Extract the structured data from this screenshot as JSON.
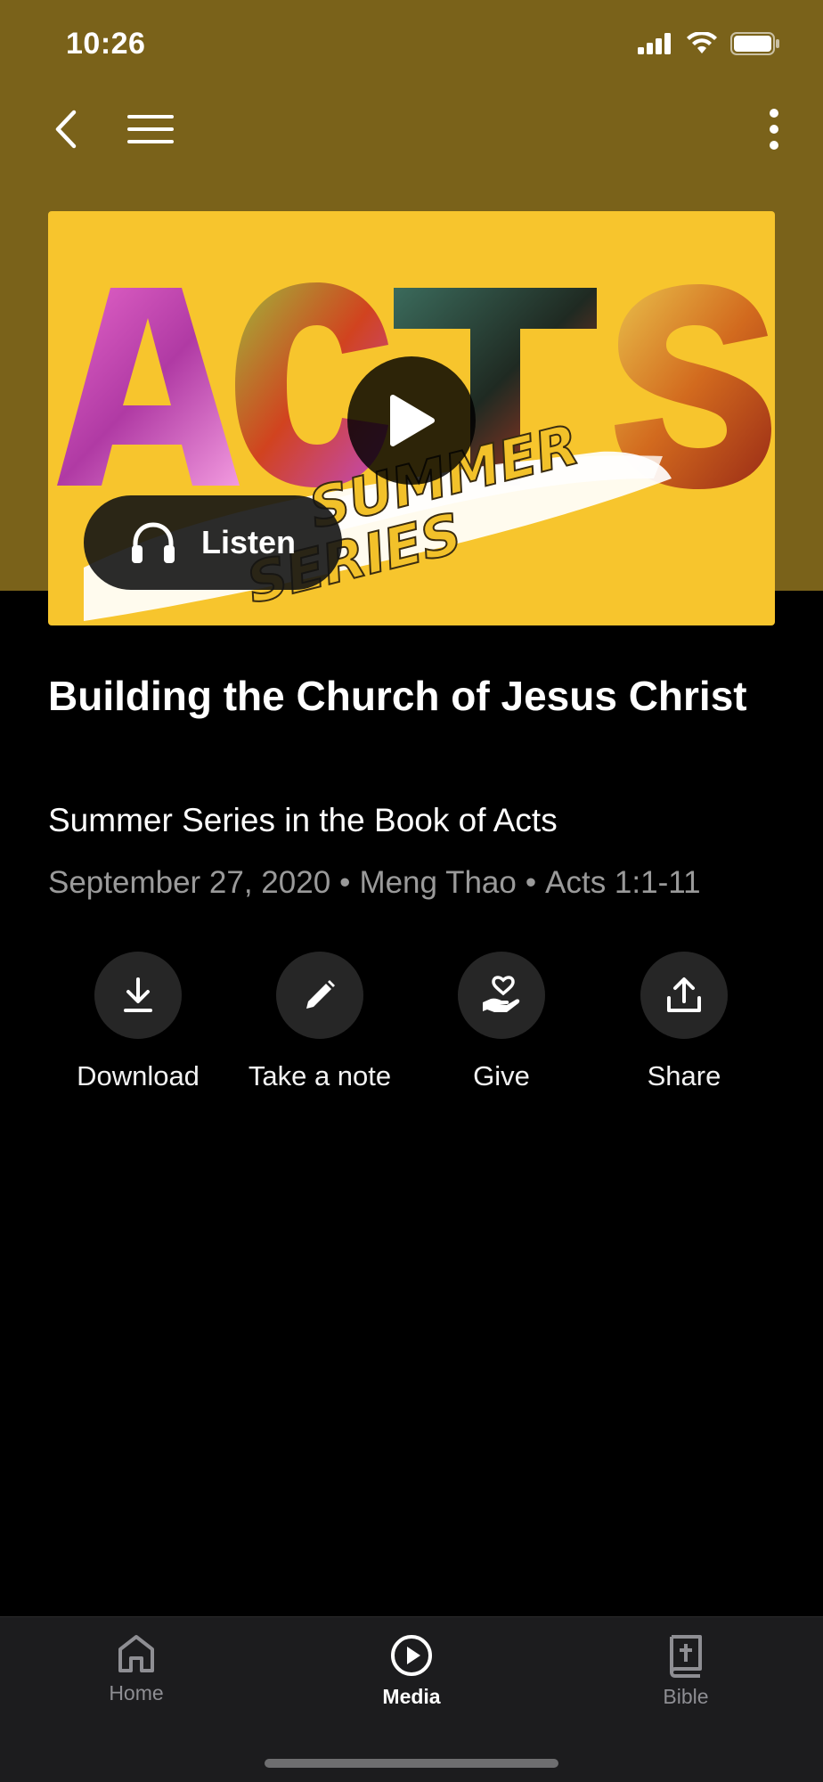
{
  "status_bar": {
    "time": "10:26"
  },
  "nav": {
    "back_icon": "chevron-left-icon",
    "menu_icon": "hamburger-icon",
    "more_icon": "more-vertical-icon"
  },
  "artwork": {
    "description_text": "ACTS",
    "secondary_text": "SUMMER SERIES",
    "listen_label": "Listen"
  },
  "media": {
    "title": "Building the Church of Jesus Christ",
    "subtitle": "Summer Series in the Book of Acts",
    "date": "September 27, 2020",
    "speaker": "Meng Thao",
    "scripture": "Acts 1:1-11",
    "separator": "•"
  },
  "actions": [
    {
      "label": "Download",
      "icon": "download-icon"
    },
    {
      "label": "Take a note",
      "icon": "pencil-icon"
    },
    {
      "label": "Give",
      "icon": "give-heart-hand-icon"
    },
    {
      "label": "Share",
      "icon": "share-icon"
    }
  ],
  "tabs": [
    {
      "label": "Home",
      "icon": "home-icon",
      "active": false
    },
    {
      "label": "Media",
      "icon": "play-circle-icon",
      "active": true
    },
    {
      "label": "Bible",
      "icon": "bible-icon",
      "active": false
    }
  ],
  "colors": {
    "header": "#7a621a",
    "artwork_bg": "#f7c52d",
    "tab_inactive": "#8e8e93",
    "tab_active": "#ffffff"
  }
}
